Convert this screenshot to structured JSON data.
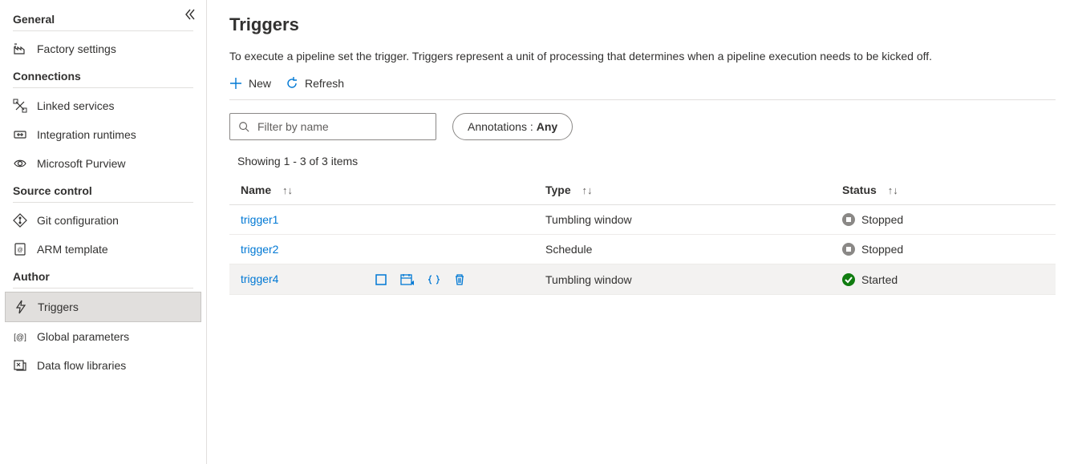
{
  "sidebar": {
    "sections": [
      {
        "title": "General",
        "items": [
          {
            "label": "Factory settings",
            "icon": "factory-settings"
          }
        ]
      },
      {
        "title": "Connections",
        "items": [
          {
            "label": "Linked services",
            "icon": "linked-services"
          },
          {
            "label": "Integration runtimes",
            "icon": "integration-runtimes"
          },
          {
            "label": "Microsoft Purview",
            "icon": "purview"
          }
        ]
      },
      {
        "title": "Source control",
        "items": [
          {
            "label": "Git configuration",
            "icon": "git"
          },
          {
            "label": "ARM template",
            "icon": "arm-template"
          }
        ]
      },
      {
        "title": "Author",
        "items": [
          {
            "label": "Triggers",
            "icon": "trigger",
            "active": true
          },
          {
            "label": "Global parameters",
            "icon": "global-params"
          },
          {
            "label": "Data flow libraries",
            "icon": "dataflow-lib"
          }
        ]
      }
    ]
  },
  "page": {
    "title": "Triggers",
    "description": "To execute a pipeline set the trigger. Triggers represent a unit of processing that determines when a pipeline execution needs to be kicked off."
  },
  "toolbar": {
    "new_label": "New",
    "refresh_label": "Refresh"
  },
  "filter": {
    "placeholder": "Filter by name",
    "annotations_label": "Annotations :",
    "annotations_value": "Any"
  },
  "showing_text": "Showing 1 - 3 of 3 items",
  "columns": {
    "name": "Name",
    "type": "Type",
    "status": "Status"
  },
  "rows": [
    {
      "name": "trigger1",
      "type": "Tumbling window",
      "status": "Stopped",
      "hover": false
    },
    {
      "name": "trigger2",
      "type": "Schedule",
      "status": "Stopped",
      "hover": false
    },
    {
      "name": "trigger4",
      "type": "Tumbling window",
      "status": "Started",
      "hover": true
    }
  ]
}
